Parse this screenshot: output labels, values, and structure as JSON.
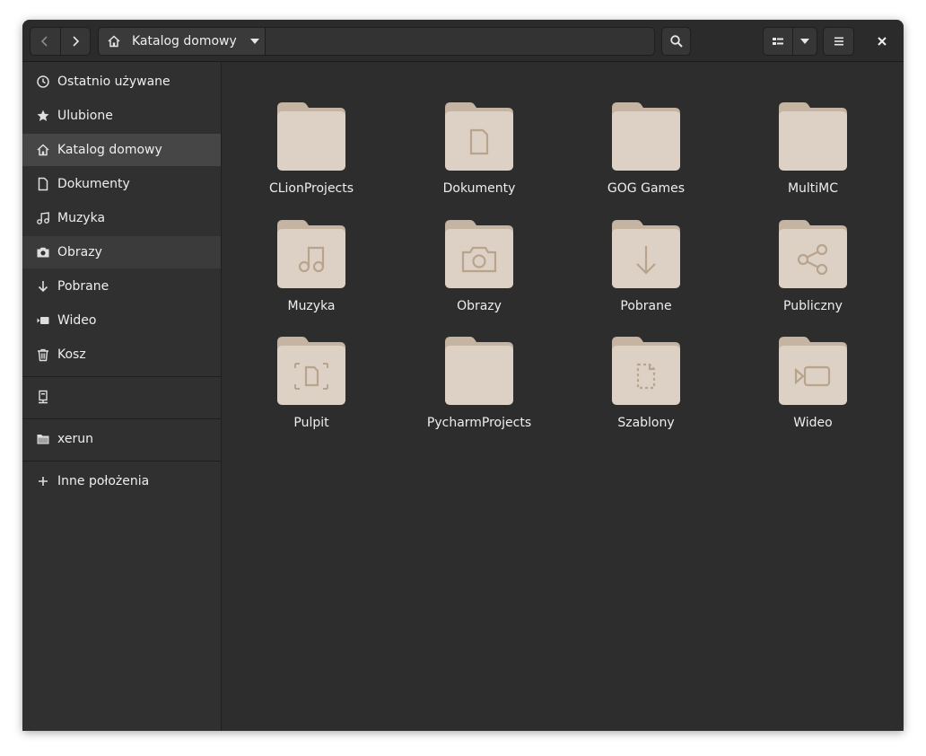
{
  "pathbar": {
    "location": "Katalog domowy"
  },
  "sidebar": {
    "items": [
      {
        "label": "Ostatnio używane",
        "icon": "clock-icon"
      },
      {
        "label": "Ulubione",
        "icon": "star-icon"
      },
      {
        "label": "Katalog domowy",
        "icon": "home-icon",
        "active": true
      },
      {
        "label": "Dokumenty",
        "icon": "document-icon"
      },
      {
        "label": "Muzyka",
        "icon": "music-icon"
      },
      {
        "label": "Obrazy",
        "icon": "camera-icon",
        "hover": true
      },
      {
        "label": "Pobrane",
        "icon": "download-icon"
      },
      {
        "label": "Wideo",
        "icon": "video-icon"
      },
      {
        "label": "Kosz",
        "icon": "trash-icon"
      }
    ],
    "drive": {
      "label": "",
      "icon": "computer-icon"
    },
    "bookmark": {
      "label": "xerun",
      "icon": "folder-icon"
    },
    "other": {
      "label": "Inne położenia",
      "icon": "plus-icon"
    }
  },
  "files": [
    {
      "name": "CLionProjects",
      "emblem": "none"
    },
    {
      "name": "Dokumenty",
      "emblem": "document"
    },
    {
      "name": "GOG Games",
      "emblem": "none"
    },
    {
      "name": "MultiMC",
      "emblem": "none"
    },
    {
      "name": "Muzyka",
      "emblem": "music"
    },
    {
      "name": "Obrazy",
      "emblem": "camera"
    },
    {
      "name": "Pobrane",
      "emblem": "download"
    },
    {
      "name": "Publiczny",
      "emblem": "share"
    },
    {
      "name": "Pulpit",
      "emblem": "desktop"
    },
    {
      "name": "PycharmProjects",
      "emblem": "none"
    },
    {
      "name": "Szablony",
      "emblem": "template"
    },
    {
      "name": "Wideo",
      "emblem": "video"
    }
  ],
  "colors": {
    "folder_back": "#c5b4a2",
    "folder_front": "#ddd1c6",
    "emblem": "#b8a38d",
    "icon": "#dedede"
  }
}
